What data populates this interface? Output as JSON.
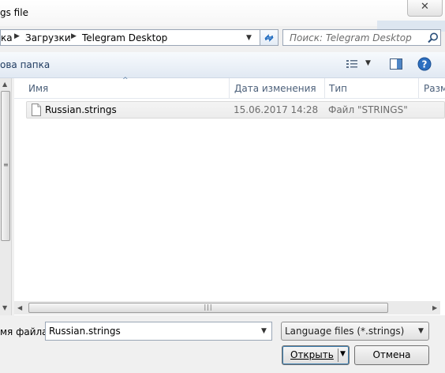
{
  "window": {
    "title": "gs file",
    "close_label": "✕"
  },
  "address": {
    "crumbs": [
      "ка",
      "Загрузки",
      "Telegram Desktop"
    ],
    "search_placeholder": "Поиск: Telegram Desktop"
  },
  "toolbar": {
    "new_folder_label": "ова папка"
  },
  "columns": {
    "name": "Имя",
    "date": "Дата изменения",
    "type": "Тип",
    "size": "Разм"
  },
  "files": [
    {
      "name": "Russian.strings",
      "date": "15.06.2017 14:28",
      "type": "Файл \"STRINGS\""
    }
  ],
  "bottom": {
    "filename_label": "мя файла:",
    "filename_value": "Russian.strings",
    "filetype_value": "Language files (*.strings)",
    "open_label": "Открыть",
    "cancel_label": "Отмена"
  },
  "colors": {
    "accent": "#1f6bbf",
    "header_text": "#4c607a",
    "toolbar_bg": "#e6edf5"
  }
}
